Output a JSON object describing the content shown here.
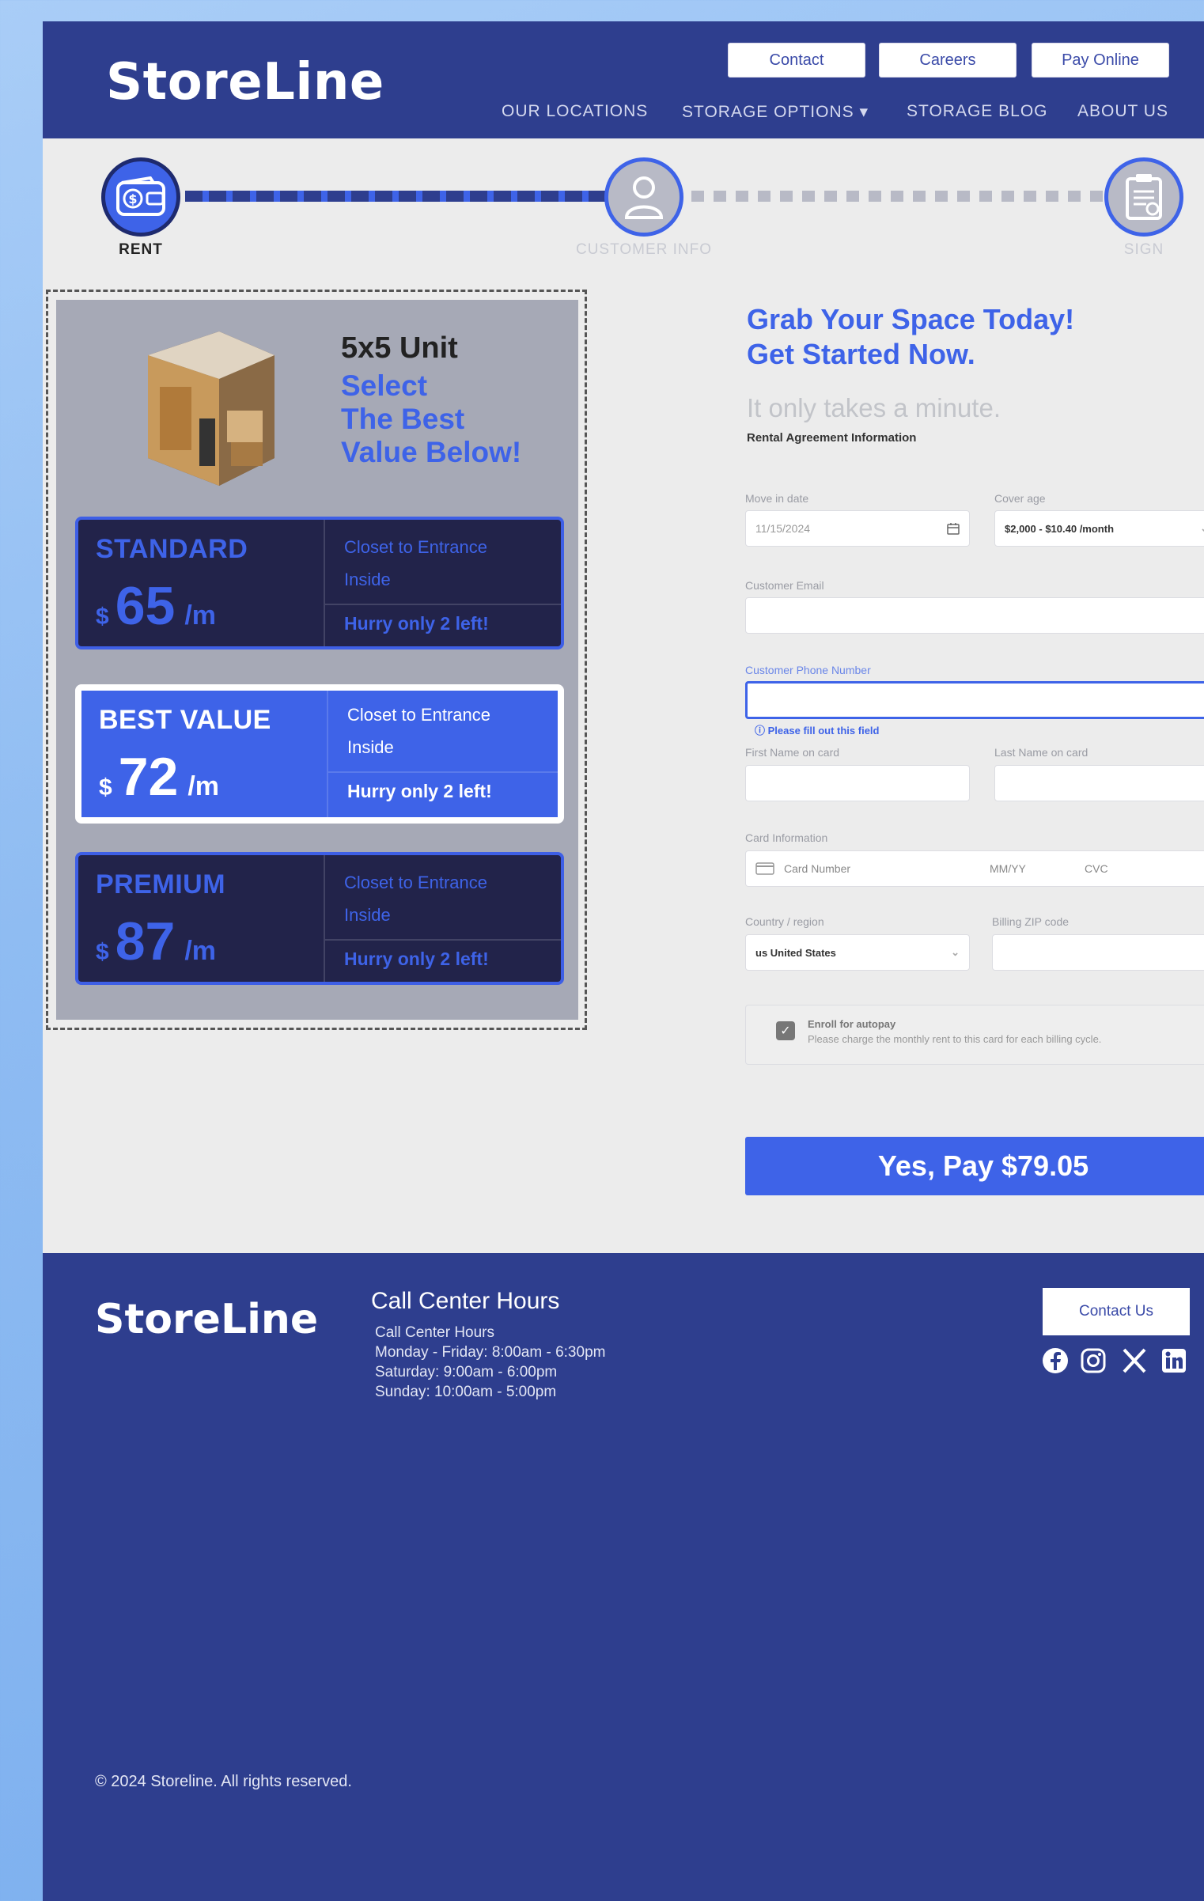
{
  "brand": "StoreLine",
  "header": {
    "buttons": [
      "Contact",
      "Careers",
      "Pay Online"
    ],
    "nav": [
      "OUR LOCATIONS",
      "STORAGE OPTIONS ▾",
      "STORAGE BLOG",
      "ABOUT US"
    ]
  },
  "stepper": {
    "steps": [
      {
        "label": "RENT",
        "icon": "wallet-icon"
      },
      {
        "label": "CUSTOMER INFO",
        "icon": "user-icon"
      },
      {
        "label": "SIGN",
        "icon": "clipboard-icon"
      }
    ]
  },
  "unit": {
    "title": "5x5 Unit",
    "subtitle_lines": [
      "Select",
      "The Best",
      "Value Below!"
    ],
    "plans": [
      {
        "name": "STANDARD",
        "currency": "$",
        "price": "65",
        "per": "/m",
        "feature1": "Closet to Entrance",
        "feature2": "Inside",
        "hurry": "Hurry only 2 left!"
      },
      {
        "name": "BEST VALUE",
        "currency": "$",
        "price": "72",
        "per": "/m",
        "feature1": "Closet to Entrance",
        "feature2": "Inside",
        "hurry": "Hurry only 2 left!"
      },
      {
        "name": "PREMIUM",
        "currency": "$",
        "price": "87",
        "per": "/m",
        "feature1": "Closet to Entrance",
        "feature2": "Inside",
        "hurry": "Hurry only 2 left!"
      }
    ]
  },
  "form": {
    "heading1": "Grab Your Space Today!",
    "heading2": "Get Started Now.",
    "subheading": "It only takes a minute.",
    "section_title": "Rental Agreement Information",
    "move_in_label": "Move in date",
    "move_in_value": "11/15/2024",
    "cover_label": "Cover age",
    "cover_value": "$2,000 - $10.40 /month",
    "email_label": "Customer Email",
    "phone_label": "Customer Phone Number",
    "phone_error": "Please fill out this field",
    "first_name_label": "First Name on card",
    "last_name_label": "Last Name on card",
    "card_label": "Card Information",
    "card_number_placeholder": "Card Number",
    "card_exp_placeholder": "MM/YY",
    "card_cvc_placeholder": "CVC",
    "country_label": "Country / region",
    "country_value": "us United States",
    "zip_label": "Billing ZIP code",
    "autopay_title": "Enroll for autopay",
    "autopay_desc": "Please charge the monthly rent to this card for each billing cycle.",
    "pay_button": "Yes, Pay $79.05"
  },
  "footer": {
    "logo": "StoreLine",
    "hours_title": "Call Center Hours",
    "hours_lines": [
      "Call Center Hours",
      "Monday - Friday: 8:00am - 6:30pm",
      "Saturday: 9:00am - 6:00pm",
      "Sunday: 10:00am - 5:00pm"
    ],
    "contact_button": "Contact Us",
    "copyright": "© 2024 Storeline. All rights reserved."
  },
  "colors": {
    "primary": "#2e3e8e",
    "accent": "#3e63e8",
    "dark_card": "#22234a"
  }
}
